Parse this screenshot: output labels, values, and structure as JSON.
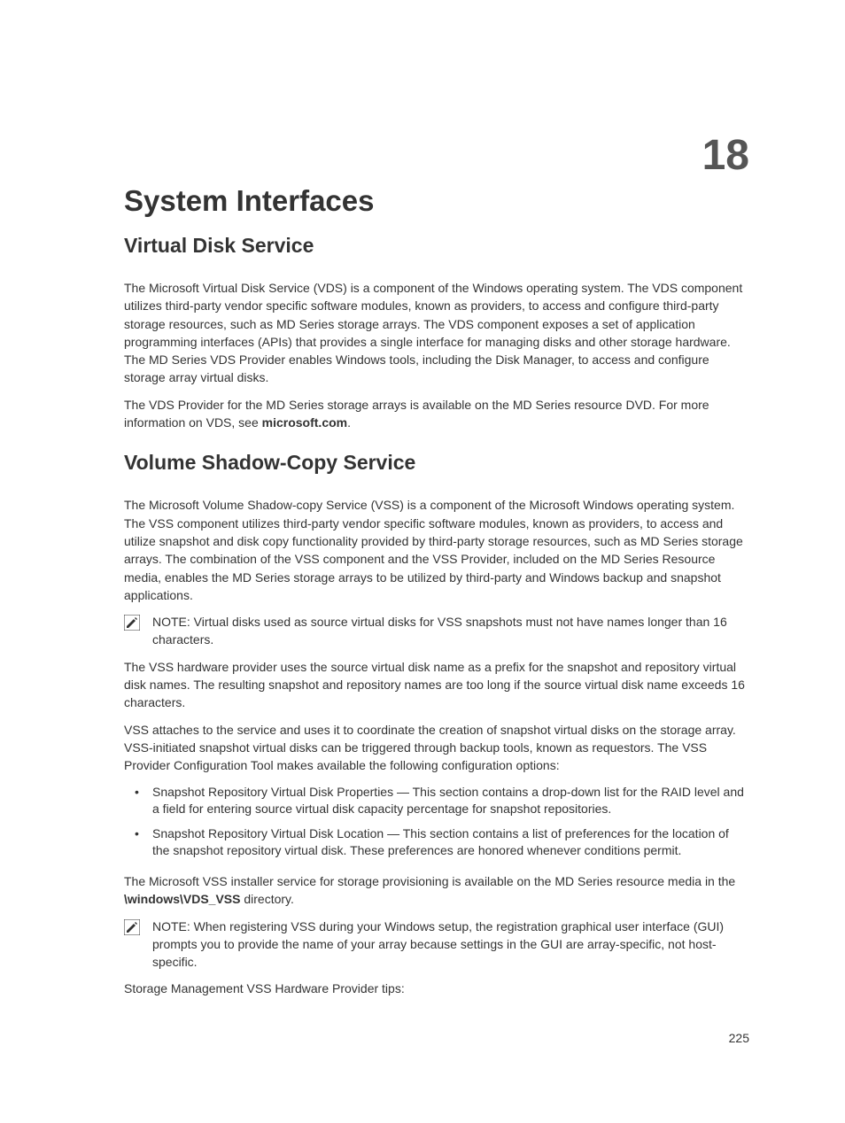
{
  "chapterNumber": "18",
  "title": "System Interfaces",
  "section1": {
    "heading": "Virtual Disk Service",
    "para1": "The Microsoft Virtual Disk Service (VDS) is a component of the Windows operating system. The VDS component utilizes third-party vendor specific software modules, known as providers, to access and configure third-party storage resources, such as MD Series storage arrays. The VDS component exposes a set of application programming interfaces (APIs) that provides a single interface for managing disks and other storage hardware. The MD Series VDS Provider enables Windows tools, including the Disk Manager, to access and configure storage array virtual disks.",
    "para2_pre": "The VDS Provider for the MD Series storage arrays is available on the MD Series resource DVD. For more information on VDS, see ",
    "para2_bold": "microsoft.com",
    "para2_post": "."
  },
  "section2": {
    "heading": "Volume Shadow-Copy Service",
    "para1": "The Microsoft Volume Shadow-copy Service (VSS) is a component of the Microsoft Windows operating system. The VSS component utilizes third-party vendor specific software modules, known as providers, to access and utilize snapshot and disk copy functionality provided by third-party storage resources, such as MD Series storage arrays. The combination of the VSS component and the VSS Provider, included on the MD Series Resource media, enables the MD Series storage arrays to be utilized by third-party and Windows backup and snapshot applications.",
    "note1_label": "NOTE: ",
    "note1_text": "Virtual disks used as source virtual disks for VSS snapshots must not have names longer than 16 characters.",
    "para2": "The VSS hardware provider uses the source virtual disk name as a prefix for the snapshot and repository virtual disk names. The resulting snapshot and repository names are too long if the source virtual disk name exceeds 16 characters.",
    "para3": "VSS attaches to the service and uses it to coordinate the creation of snapshot virtual disks on the storage array. VSS-initiated snapshot virtual disks can be triggered through backup tools, known as requestors. The VSS Provider Configuration Tool makes available the following configuration options:",
    "bullets": [
      "Snapshot Repository Virtual Disk Properties — This section contains a drop-down list for the RAID level and a field for entering source virtual disk capacity percentage for snapshot repositories.",
      "Snapshot Repository Virtual Disk Location — This section contains a list of preferences for the location of the snapshot repository virtual disk. These preferences are honored whenever conditions permit."
    ],
    "para4_pre": "The Microsoft VSS installer service for storage provisioning is available on the MD Series resource media in the ",
    "para4_bold": "\\windows\\VDS_VSS",
    "para4_post": " directory.",
    "note2_label": "NOTE: ",
    "note2_text": "When registering VSS during your Windows setup, the registration graphical user interface (GUI) prompts you to provide the name of your array because settings in the GUI are array-specific, not host-specific.",
    "para5": "Storage Management VSS Hardware Provider tips:"
  },
  "pageNumber": "225"
}
